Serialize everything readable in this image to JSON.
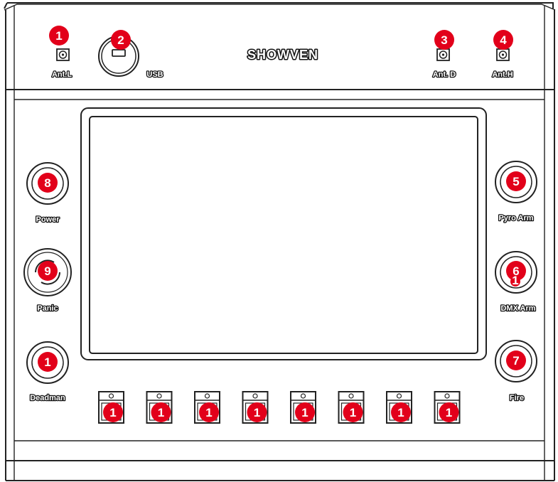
{
  "device": {
    "brand": "SHOWVEN"
  },
  "top_panel": {
    "ant_l": {
      "label": "Ant.L",
      "badge": "1"
    },
    "usb": {
      "label": "USB",
      "badge": "2"
    },
    "ant_d": {
      "label": "Ant. D",
      "badge": "3"
    },
    "ant_h": {
      "label": "Ant.H",
      "badge": "4"
    }
  },
  "left_buttons": [
    {
      "label": "Power",
      "badge": "8"
    },
    {
      "label": "Panic",
      "badge": "9"
    },
    {
      "label": "Deadman",
      "badge": "1"
    }
  ],
  "right_buttons": [
    {
      "label": "Pyro Arm",
      "badge": "5"
    },
    {
      "label": "DMX Arm",
      "badge": "6",
      "sub_badge": "1"
    },
    {
      "label": "Fire",
      "badge": "7"
    }
  ],
  "channel_keys": [
    {
      "badge": "1"
    },
    {
      "badge": "1"
    },
    {
      "badge": "1"
    },
    {
      "badge": "1"
    },
    {
      "badge": "1"
    },
    {
      "badge": "1"
    },
    {
      "badge": "1"
    },
    {
      "badge": "1"
    }
  ],
  "colors": {
    "badge": "#e2001a",
    "outline": "#222222",
    "panel": "#ffffff"
  }
}
